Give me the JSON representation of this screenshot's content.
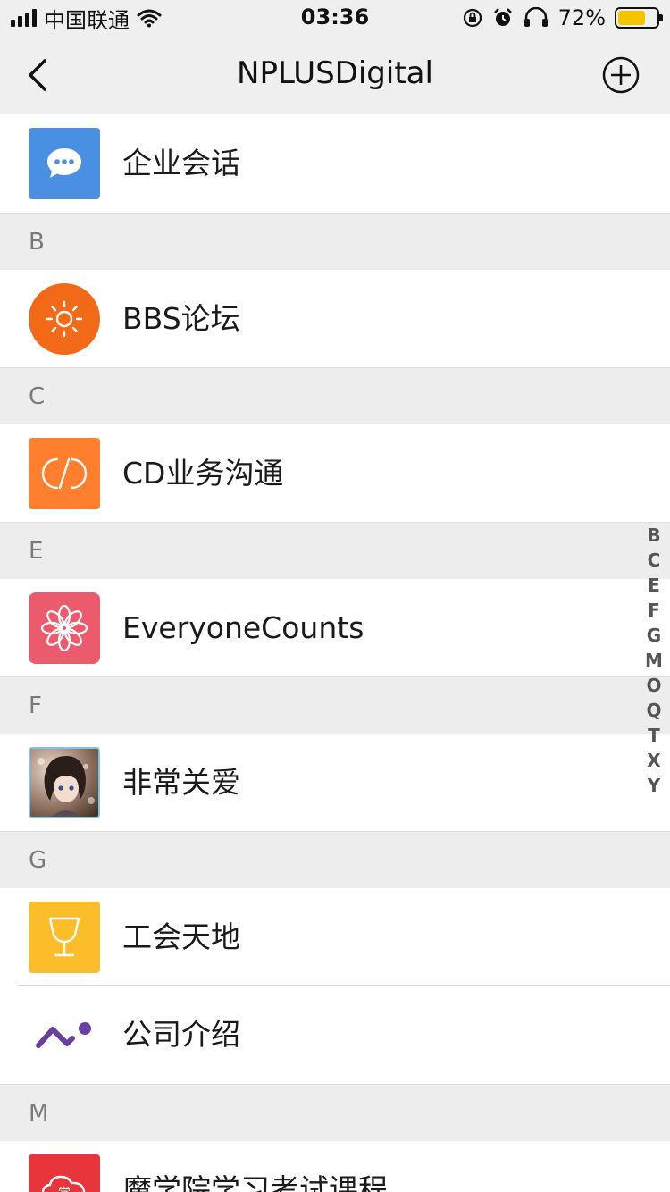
{
  "status_bar": {
    "carrier": "中国联通",
    "time": "03:36",
    "battery_percent": "72%",
    "battery_level": 0.72
  },
  "nav": {
    "title": "NPLUSDigital"
  },
  "list": {
    "top_item": {
      "label": "企业会话",
      "icon": "chat-bubble-icon",
      "color": "#4a90e2"
    },
    "sections": [
      {
        "letter": "B",
        "items": [
          {
            "label": "BBS论坛",
            "icon": "sun-icon",
            "color": "#f26a17"
          }
        ]
      },
      {
        "letter": "C",
        "items": [
          {
            "label": "CD业务沟通",
            "icon": "cd-logo-icon",
            "color": "#ff7f2e"
          }
        ]
      },
      {
        "letter": "E",
        "items": [
          {
            "label": "EveryoneCounts",
            "icon": "flower-icon",
            "color": "#ec5a6e"
          }
        ]
      },
      {
        "letter": "F",
        "items": [
          {
            "label": "非常关爱",
            "icon": "avatar-photo",
            "color": "#8b6e5c"
          }
        ]
      },
      {
        "letter": "G",
        "items": [
          {
            "label": "工会天地",
            "icon": "trophy-icon",
            "color": "#fbbd2a"
          },
          {
            "label": "公司介绍",
            "icon": "company-logo-icon",
            "color": "#6b3fa0"
          }
        ]
      },
      {
        "letter": "M",
        "items": [
          {
            "label": "魔学院学习考试课程",
            "icon": "cloud-logo-icon",
            "color": "#e8353b"
          }
        ]
      }
    ]
  },
  "index_letters": [
    "B",
    "C",
    "E",
    "F",
    "G",
    "M",
    "O",
    "Q",
    "T",
    "X",
    "Y"
  ]
}
